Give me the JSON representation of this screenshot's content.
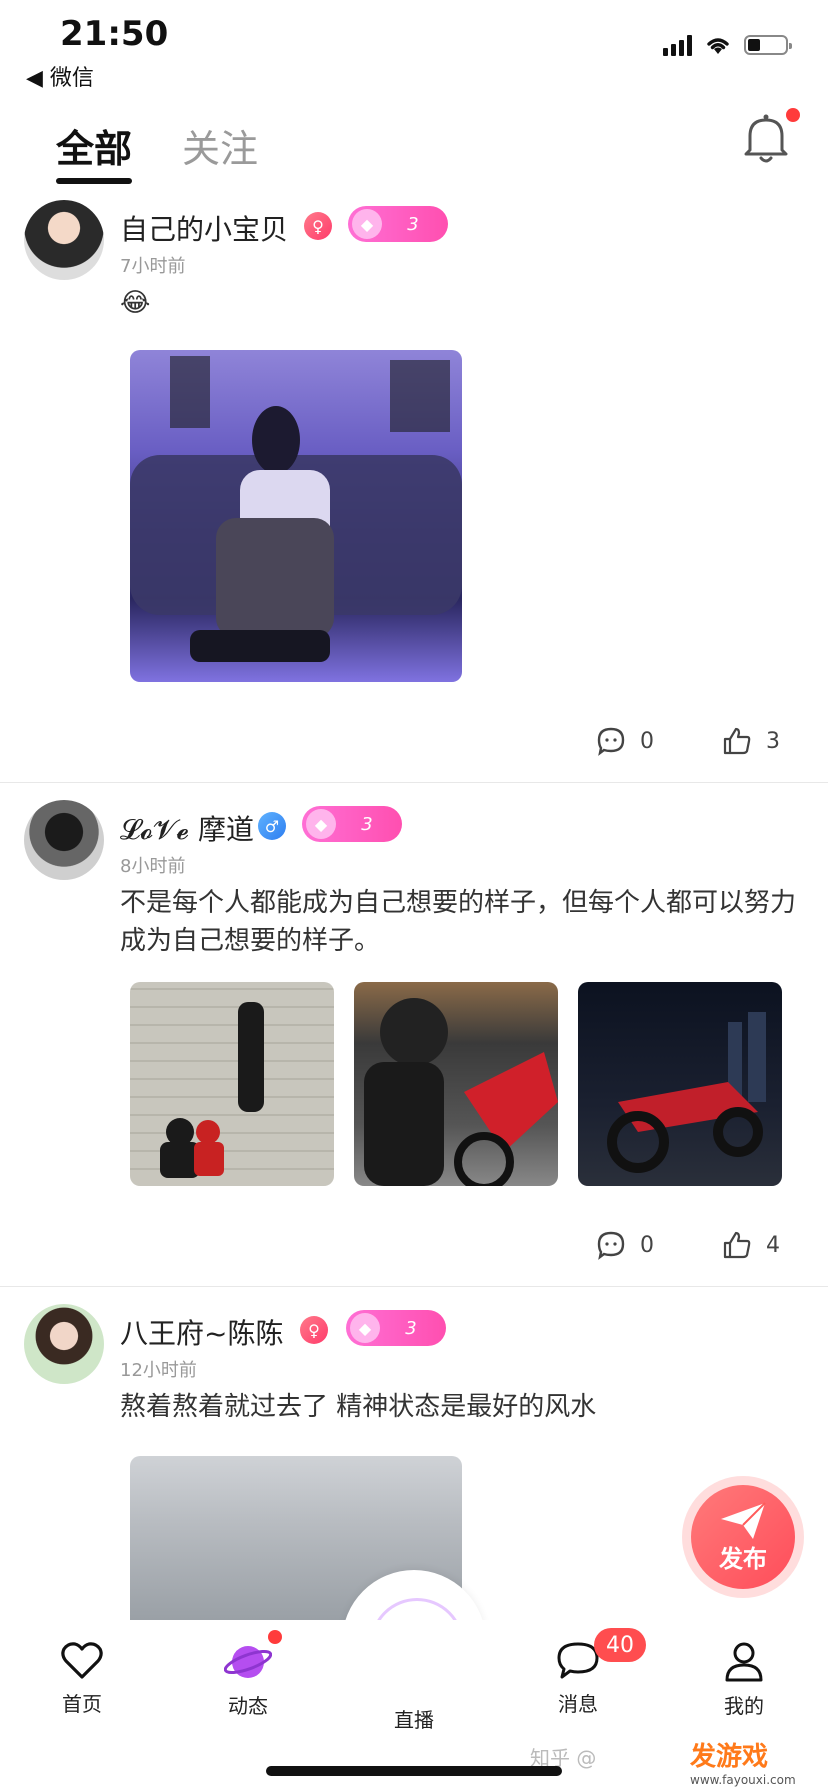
{
  "status_bar": {
    "time": "21:50",
    "back_label": "◀ 微信"
  },
  "tabs": [
    {
      "label": "全部"
    },
    {
      "label": "关注"
    }
  ],
  "posts": [
    {
      "username": "自己的小宝贝",
      "level": "3",
      "time": "7小时前",
      "text": "😂",
      "comments": "0",
      "likes": "3"
    },
    {
      "username": "𝓛𝓸𝓥𝓮 摩道",
      "level": "3",
      "time": "8小时前",
      "text": "不是每个人都能成为自己想要的样子，但每个人都可以努力成为自己想要的样子。",
      "comments": "0",
      "likes": "4"
    },
    {
      "username": "八王府~陈陈",
      "level": "3",
      "time": "12小时前",
      "text": "熬着熬着就过去了  精神状态是最好的风水"
    }
  ],
  "fab": {
    "label": "发布"
  },
  "nav": [
    {
      "label": "首页"
    },
    {
      "label": "动态"
    },
    {
      "label": "直播"
    },
    {
      "label": "消息",
      "badge": "40"
    },
    {
      "label": "我的"
    }
  ],
  "watermark": {
    "text": "知乎 @",
    "brand": "发游戏",
    "brand_url": "www.fayouxi.com"
  },
  "colors": {
    "accent": "#ff4fb0",
    "badge_red": "#ff4d4f",
    "fab": "#ff5a5a"
  }
}
